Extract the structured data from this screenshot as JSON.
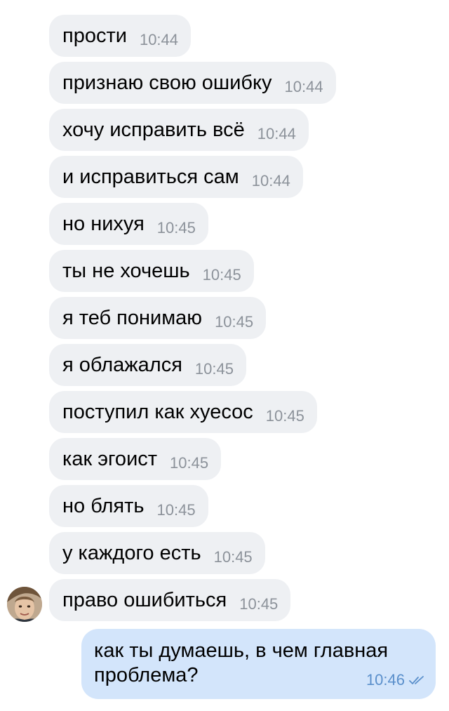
{
  "messages": [
    {
      "text": "прости",
      "time": "10:44"
    },
    {
      "text": "признаю свою ошибку",
      "time": "10:44"
    },
    {
      "text": "хочу исправить всё",
      "time": "10:44"
    },
    {
      "text": "и исправиться сам",
      "time": "10:44"
    },
    {
      "text": "но нихуя",
      "time": "10:45"
    },
    {
      "text": "ты не хочешь",
      "time": "10:45"
    },
    {
      "text": "я теб понимаю",
      "time": "10:45"
    },
    {
      "text": "я облажался",
      "time": "10:45"
    },
    {
      "text": "поступил как хуесос",
      "time": "10:45"
    },
    {
      "text": "как эгоист",
      "time": "10:45"
    },
    {
      "text": "но блять",
      "time": "10:45"
    },
    {
      "text": "у каждого есть",
      "time": "10:45"
    },
    {
      "text": "право ошибиться",
      "time": "10:45"
    }
  ],
  "outgoing": {
    "text": "как ты думаешь, в чем главная\nпроблема?",
    "time": "10:46",
    "status_icon": "double-check-icon"
  },
  "avatar_icon": "contact-avatar",
  "colors": {
    "incoming_bubble": "#eef0f3",
    "outgoing_bubble": "#d3e5fb",
    "incoming_time": "#8c929a",
    "outgoing_time": "#5a8fcb"
  }
}
